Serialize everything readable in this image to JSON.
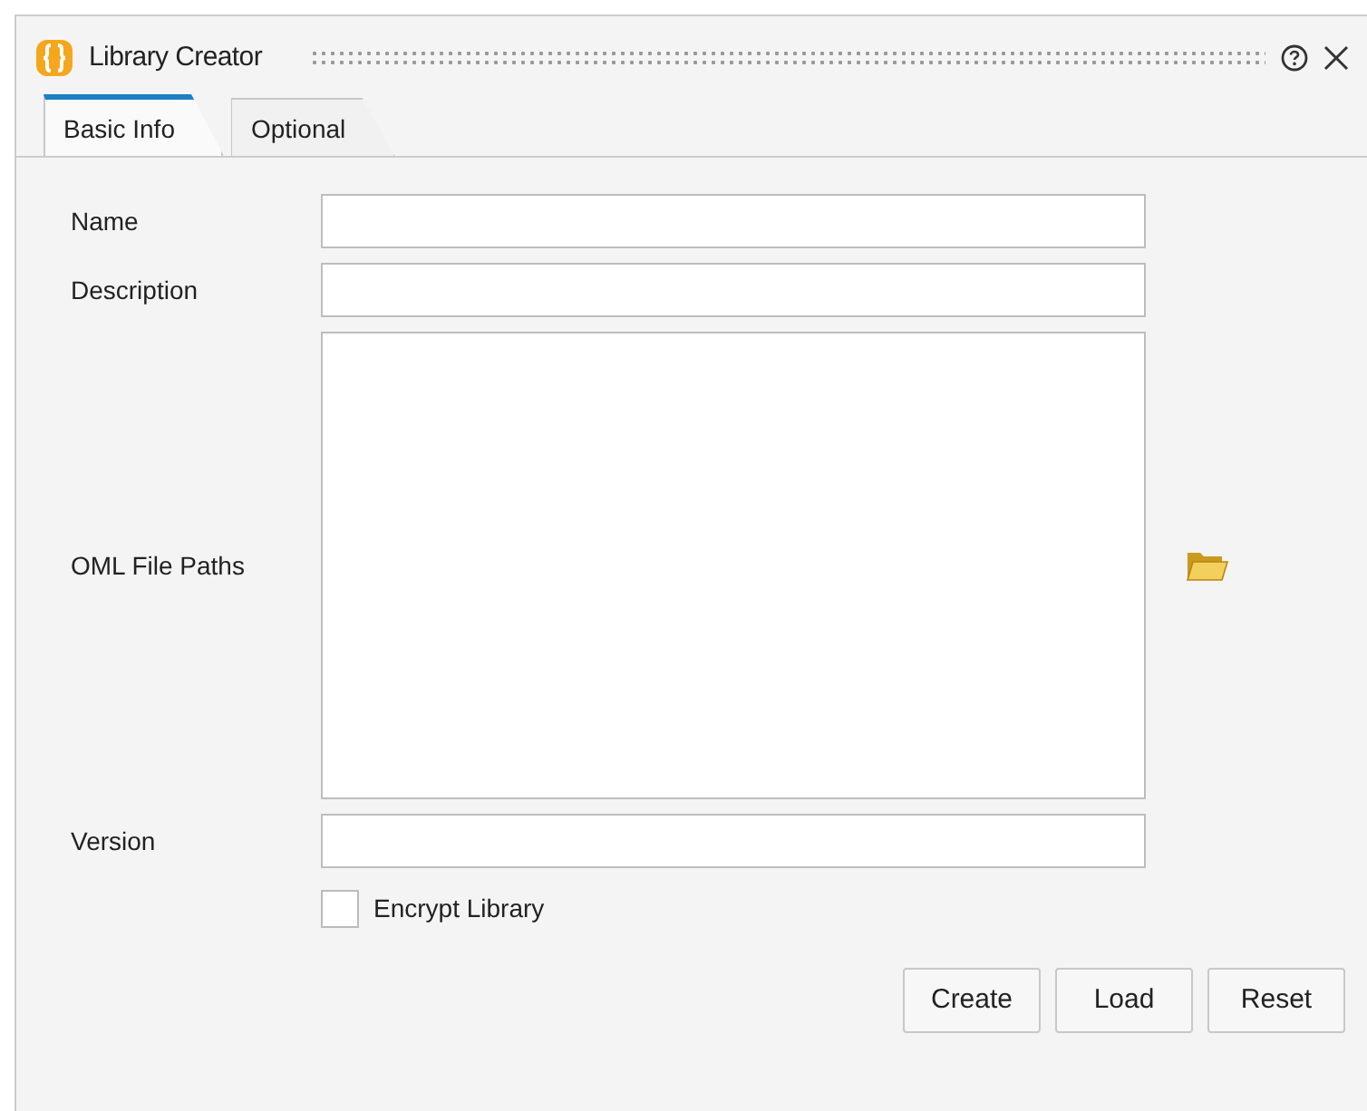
{
  "window": {
    "title": "Library Creator"
  },
  "tabs": [
    {
      "label": "Basic Info",
      "selected": true
    },
    {
      "label": "Optional",
      "selected": false
    }
  ],
  "fields": [
    {
      "label": "Name",
      "kind": "text"
    },
    {
      "label": "Description",
      "kind": "text"
    },
    {
      "label": "OML File Paths",
      "kind": "textarea",
      "browse": true
    },
    {
      "label": "Version",
      "kind": "text"
    }
  ],
  "checkbox": {
    "label": "Encrypt Library",
    "checked": false
  },
  "buttons": [
    "Create",
    "Load",
    "Reset"
  ]
}
